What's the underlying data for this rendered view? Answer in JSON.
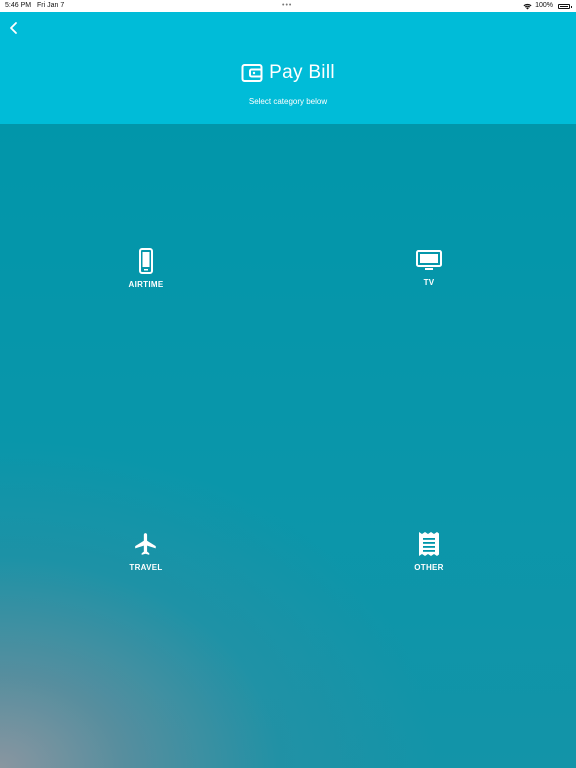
{
  "status_bar": {
    "time": "5:46 PM",
    "date": "Fri Jan 7",
    "battery": "100%"
  },
  "header": {
    "title": "Pay Bill",
    "subtitle": "Select category below",
    "title_icon": "wallet-icon",
    "back_icon": "back-chevron-icon"
  },
  "categories": [
    {
      "label": "AIRTIME",
      "icon": "phone-icon"
    },
    {
      "label": "TV",
      "icon": "tv-icon"
    },
    {
      "label": "TRAVEL",
      "icon": "airplane-icon"
    },
    {
      "label": "OTHER",
      "icon": "receipt-icon"
    }
  ],
  "colors": {
    "header_bg": "#00bcd8",
    "content_bg": "#0096aa",
    "text": "#ffffff"
  }
}
